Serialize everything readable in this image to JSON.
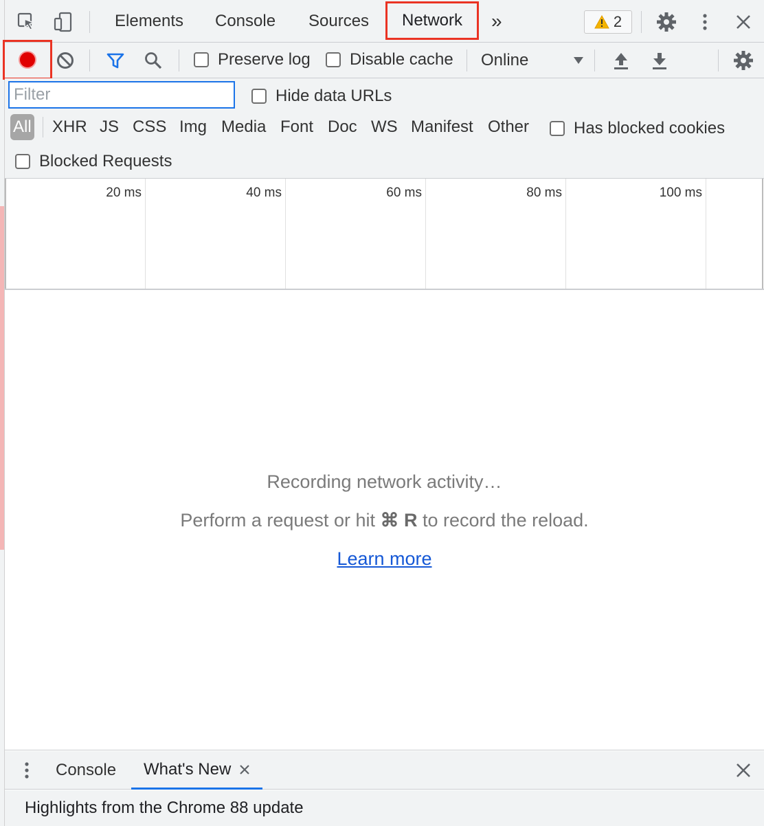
{
  "top_tabs": {
    "elements": "Elements",
    "console": "Console",
    "sources": "Sources",
    "network": "Network",
    "more": "»"
  },
  "warnings": {
    "count": "2"
  },
  "toolbar": {
    "preserve_log": "Preserve log",
    "disable_cache": "Disable cache",
    "throttling": "Online"
  },
  "filter": {
    "placeholder": "Filter",
    "hide_data_urls": "Hide data URLs",
    "types": [
      "All",
      "XHR",
      "JS",
      "CSS",
      "Img",
      "Media",
      "Font",
      "Doc",
      "WS",
      "Manifest",
      "Other"
    ],
    "has_blocked_cookies": "Has blocked cookies",
    "blocked_requests": "Blocked Requests"
  },
  "timeline": {
    "ticks": [
      "20 ms",
      "40 ms",
      "60 ms",
      "80 ms",
      "100 ms"
    ]
  },
  "empty_state": {
    "recording": "Recording network activity…",
    "hint_prefix": "Perform a request or hit",
    "hint_key": "⌘ R",
    "hint_suffix": "to record the reload.",
    "learn_more": "Learn more"
  },
  "drawer": {
    "console_tab": "Console",
    "whats_new_tab": "What's New",
    "highlights": "Highlights from the Chrome 88 update"
  },
  "colors": {
    "accent": "#1a73e8",
    "record": "#e00000",
    "highlight_box": "#ea3323",
    "toolbar_bg": "#f1f3f4"
  }
}
